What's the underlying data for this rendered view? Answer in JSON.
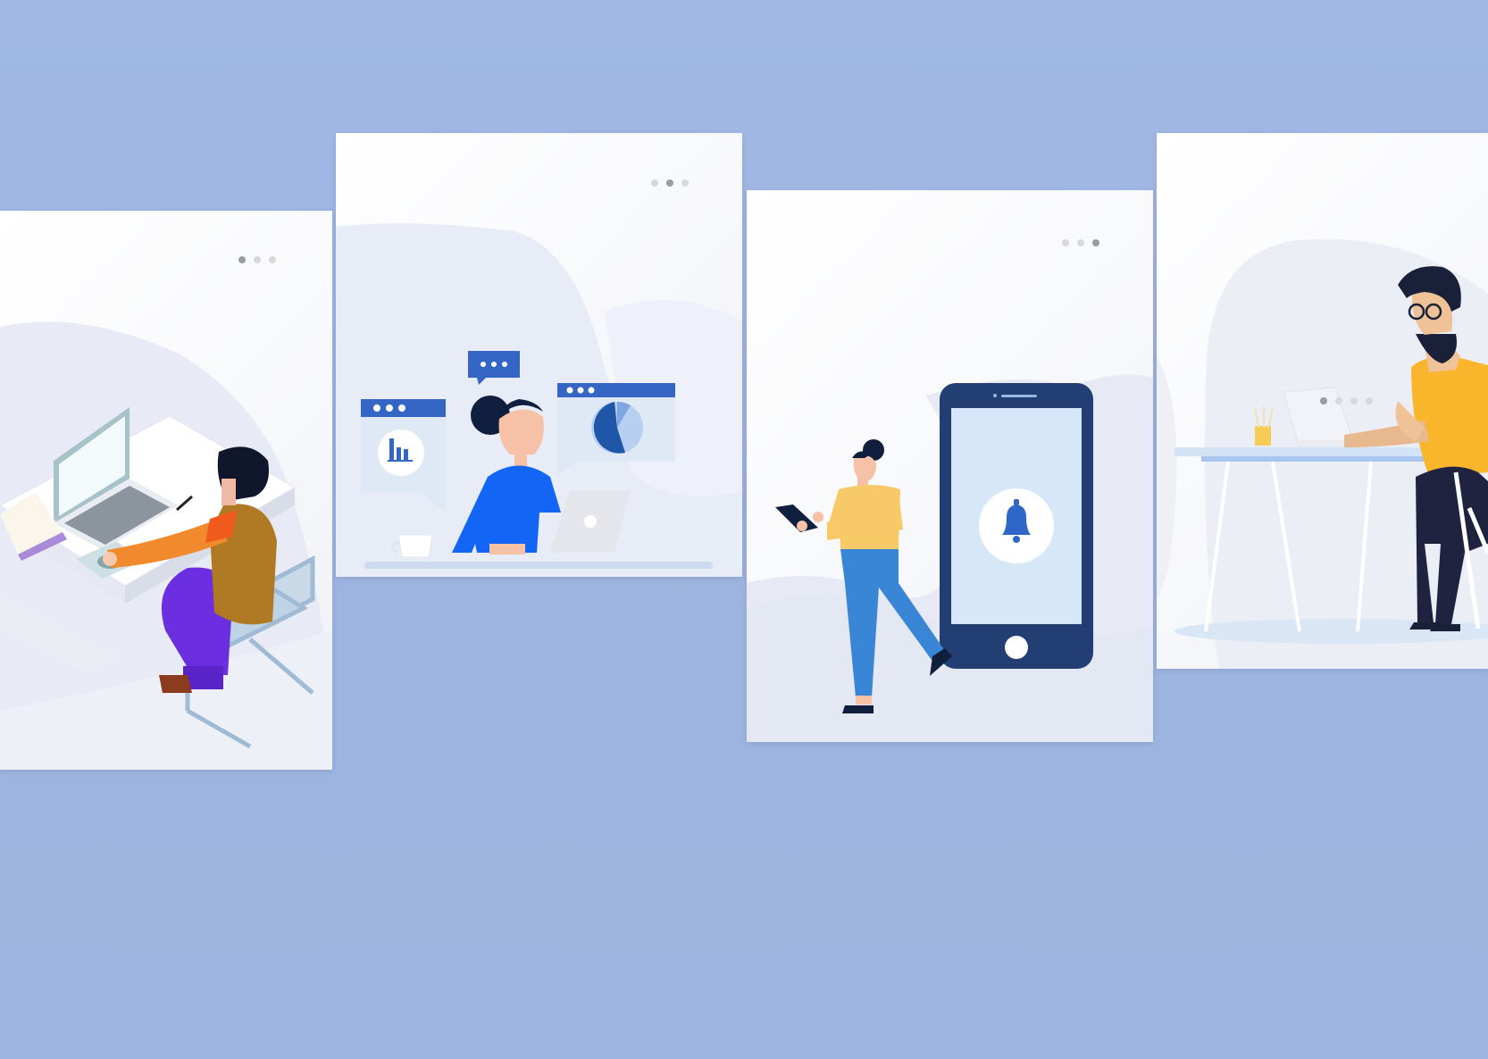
{
  "colors": {
    "page_background": "#a1b8e6",
    "card_background": "#ffffff",
    "accent_blue": "#2f66c8",
    "navy": "#233e73",
    "yellow": "#f7c94d",
    "orange": "#f08a2c",
    "purple": "#6b2ee0",
    "dot_inactive": "#d6d8de",
    "dot_active": "#9a9ca3"
  },
  "slides": [
    {
      "id": "desk-worker",
      "dots_total": 3,
      "active_dot": 1
    },
    {
      "id": "dashboard-analytics",
      "dots_total": 3,
      "active_dot": 2
    },
    {
      "id": "mobile-notification",
      "dots_total": 3,
      "active_dot": 3
    },
    {
      "id": "laptop-developer",
      "dots_total": 4,
      "active_dot": 1
    }
  ],
  "icons": [
    "laptop-icon",
    "chat-bubble-icon",
    "bar-chart-icon",
    "pie-chart-icon",
    "bell-icon",
    "smartphone-icon",
    "tablet-icon",
    "coffee-cup-icon"
  ]
}
